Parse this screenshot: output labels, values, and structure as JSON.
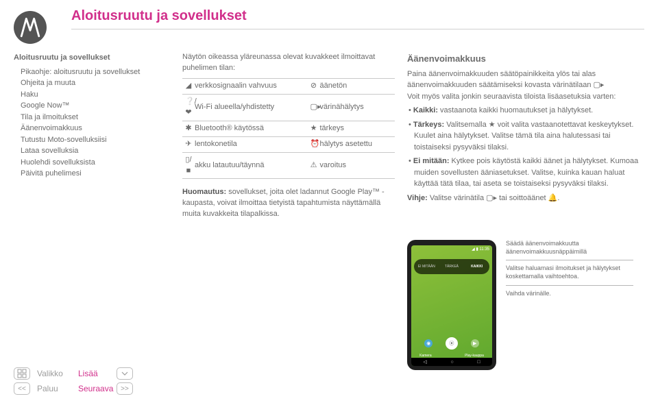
{
  "page_title": "Aloitusruutu ja sovellukset",
  "sidebar": {
    "section_title": "Aloitusruutu ja sovellukset",
    "items": [
      "Pikaohje: aloitusruutu ja sovellukset",
      "Ohjeita ja muuta",
      "Haku",
      "Google Now™",
      "Tila ja ilmoitukset",
      "Äänenvoimakkuus",
      "Tutustu Moto-sovelluksiisi",
      "Lataa sovelluksia",
      "Huolehdi sovelluksista",
      "Päivitä puhelimesi"
    ]
  },
  "col2": {
    "intro": "Näytön oikeassa yläreunassa olevat kuvakkeet ilmoittavat puhelimen tilan:",
    "rows": [
      {
        "i1": "◢",
        "l1": "verkkosignaalin vahvuus",
        "i2": "⊘",
        "l2": "äänetön"
      },
      {
        "i1": "❔/❤",
        "l1": "Wi-Fi alueella/yhdistetty",
        "i2": "▢▸",
        "l2": "värinähälytys"
      },
      {
        "i1": "✱",
        "l1": "Bluetooth® käytössä",
        "i2": "★",
        "l2": "tärkeys"
      },
      {
        "i1": "✈",
        "l1": "lentokonetila",
        "i2": "⏰",
        "l2": "hälytys asetettu"
      },
      {
        "i1": "▯/■",
        "l1": "akku latautuu/täynnä",
        "i2": "⚠",
        "l2": "varoitus"
      }
    ],
    "note_prefix": "Huomautus:",
    "note_body": " sovellukset, joita olet ladannut Google Play™ -kaupasta, voivat ilmoittaa tietyistä tapahtumista näyttämällä muita kuvakkeita tilapalkissa."
  },
  "col3": {
    "heading": "Äänenvoimakkuus",
    "p1_a": "Paina äänenvoimakkuuden säätöpainikkeita ylös tai alas äänenvoimakkuuden säätämiseksi kovasta värinätilaan ",
    "p1_icon": "▢▸",
    "p1_b": ".",
    "p2": "Voit myös valita jonkin seuraavista tiloista lisäasetuksia varten:",
    "bullets": [
      {
        "label": "Kaikki:",
        "text": " vastaanota kaikki huomautukset ja hälytykset."
      },
      {
        "label": "Tärkeys:",
        "text": " Valitsemalla ★ voit valita vastaanotettavat keskeytykset. Kuulet aina hälytykset. Valitse tämä tila aina halutessasi tai toistaiseksi pysyväksi tilaksi."
      },
      {
        "label": "Ei mitään:",
        "text": " Kytkee pois käytöstä kaikki äänet ja hälytykset. Kumoaa muiden sovellusten ääniasetukset. Valitse, kuinka kauan haluat käyttää tätä tilaa, tai aseta se toistaiseksi pysyväksi tilaksi."
      }
    ],
    "tip_prefix": "Vihje:",
    "tip_body": " Valitse värinätila ▢▸ tai soittoäänet 🔔."
  },
  "phone": {
    "time": "11:35",
    "vol_segments": [
      "EI MITÄÄN",
      "TÄRKEÄ",
      "KAIKKI"
    ],
    "dock_labels": [
      "Kamera",
      "",
      "Play-kauppa"
    ]
  },
  "callouts": [
    "Säädä äänenvoimakkuutta äänenvoimakkuusnäppäimillä",
    "Valitse haluamasi ilmoitukset ja hälytykset koskettamalla vaihtoehtoa.",
    "Vaihda värinälle."
  ],
  "nav": {
    "menu": "Valikko",
    "more": "Lisää",
    "back": "Paluu",
    "next": "Seuraava"
  }
}
